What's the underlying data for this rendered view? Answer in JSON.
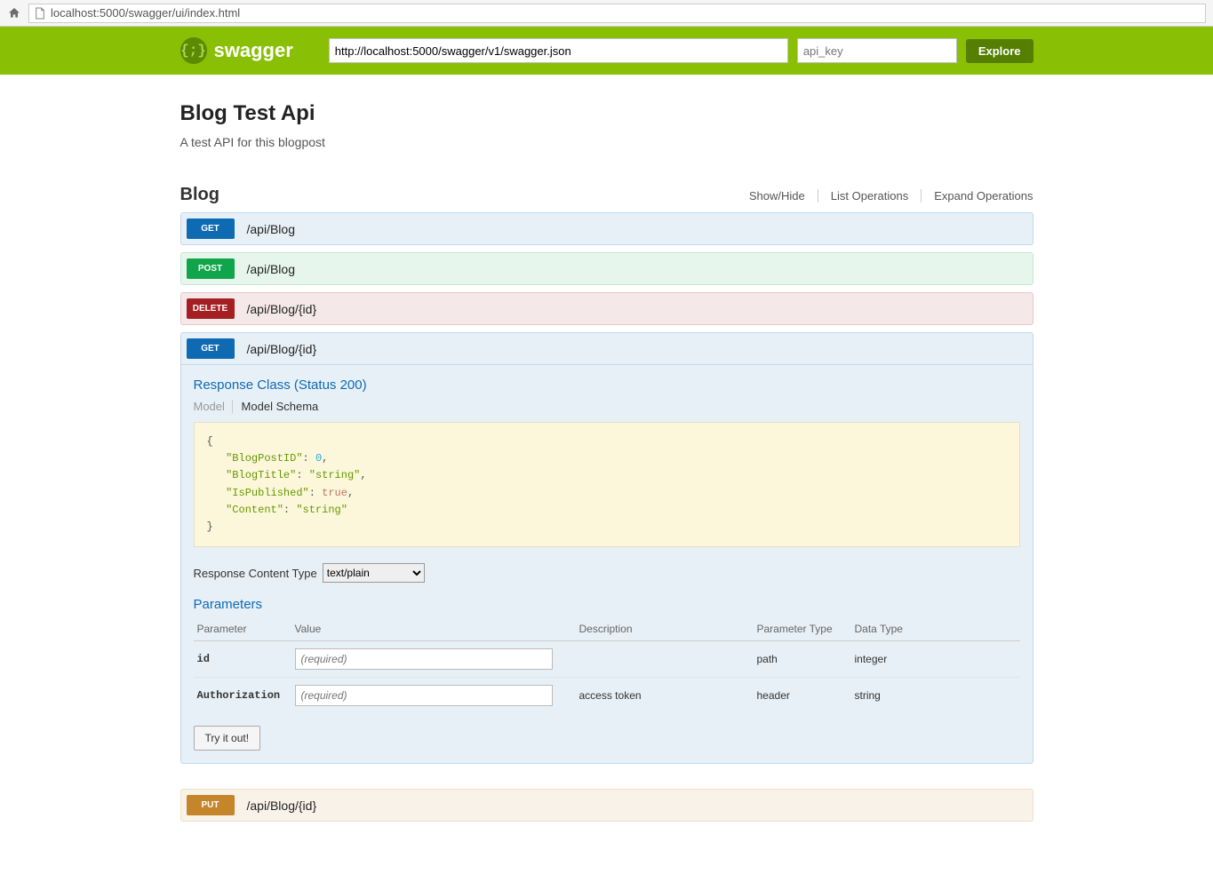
{
  "browser": {
    "url": "localhost:5000/swagger/ui/index.html"
  },
  "header": {
    "brand": "swagger",
    "logo_glyph": "{;}",
    "json_url": "http://localhost:5000/swagger/v1/swagger.json",
    "api_key_placeholder": "api_key",
    "explore": "Explore"
  },
  "meta": {
    "title": "Blog Test Api",
    "description": "A test API for this blogpost"
  },
  "section": {
    "name": "Blog",
    "links": {
      "showhide": "Show/Hide",
      "list": "List Operations",
      "expand": "Expand Operations"
    }
  },
  "ops": [
    {
      "method": "GET",
      "path": "/api/Blog",
      "cls": "get"
    },
    {
      "method": "POST",
      "path": "/api/Blog",
      "cls": "post"
    },
    {
      "method": "DELETE",
      "path": "/api/Blog/{id}",
      "cls": "delete"
    },
    {
      "method": "GET",
      "path": "/api/Blog/{id}",
      "cls": "get"
    }
  ],
  "detail": {
    "response_title": "Response Class (Status 200)",
    "model_tab": "Model",
    "schema_tab": "Model Schema",
    "schema": {
      "BlogPostID": 0,
      "BlogTitle": "string",
      "IsPublished": true,
      "Content": "string"
    },
    "rct_label": "Response Content Type",
    "rct_value": "text/plain",
    "params_title": "Parameters",
    "columns": {
      "parameter": "Parameter",
      "value": "Value",
      "description": "Description",
      "ptype": "Parameter Type",
      "dtype": "Data Type"
    },
    "rows": [
      {
        "name": "id",
        "placeholder": "(required)",
        "description": "",
        "ptype": "path",
        "dtype": "integer"
      },
      {
        "name": "Authorization",
        "placeholder": "(required)",
        "description": "access token",
        "ptype": "header",
        "dtype": "string"
      }
    ],
    "try": "Try it out!"
  },
  "next_op": {
    "method": "PUT",
    "path": "/api/Blog/{id}",
    "cls": "put"
  }
}
